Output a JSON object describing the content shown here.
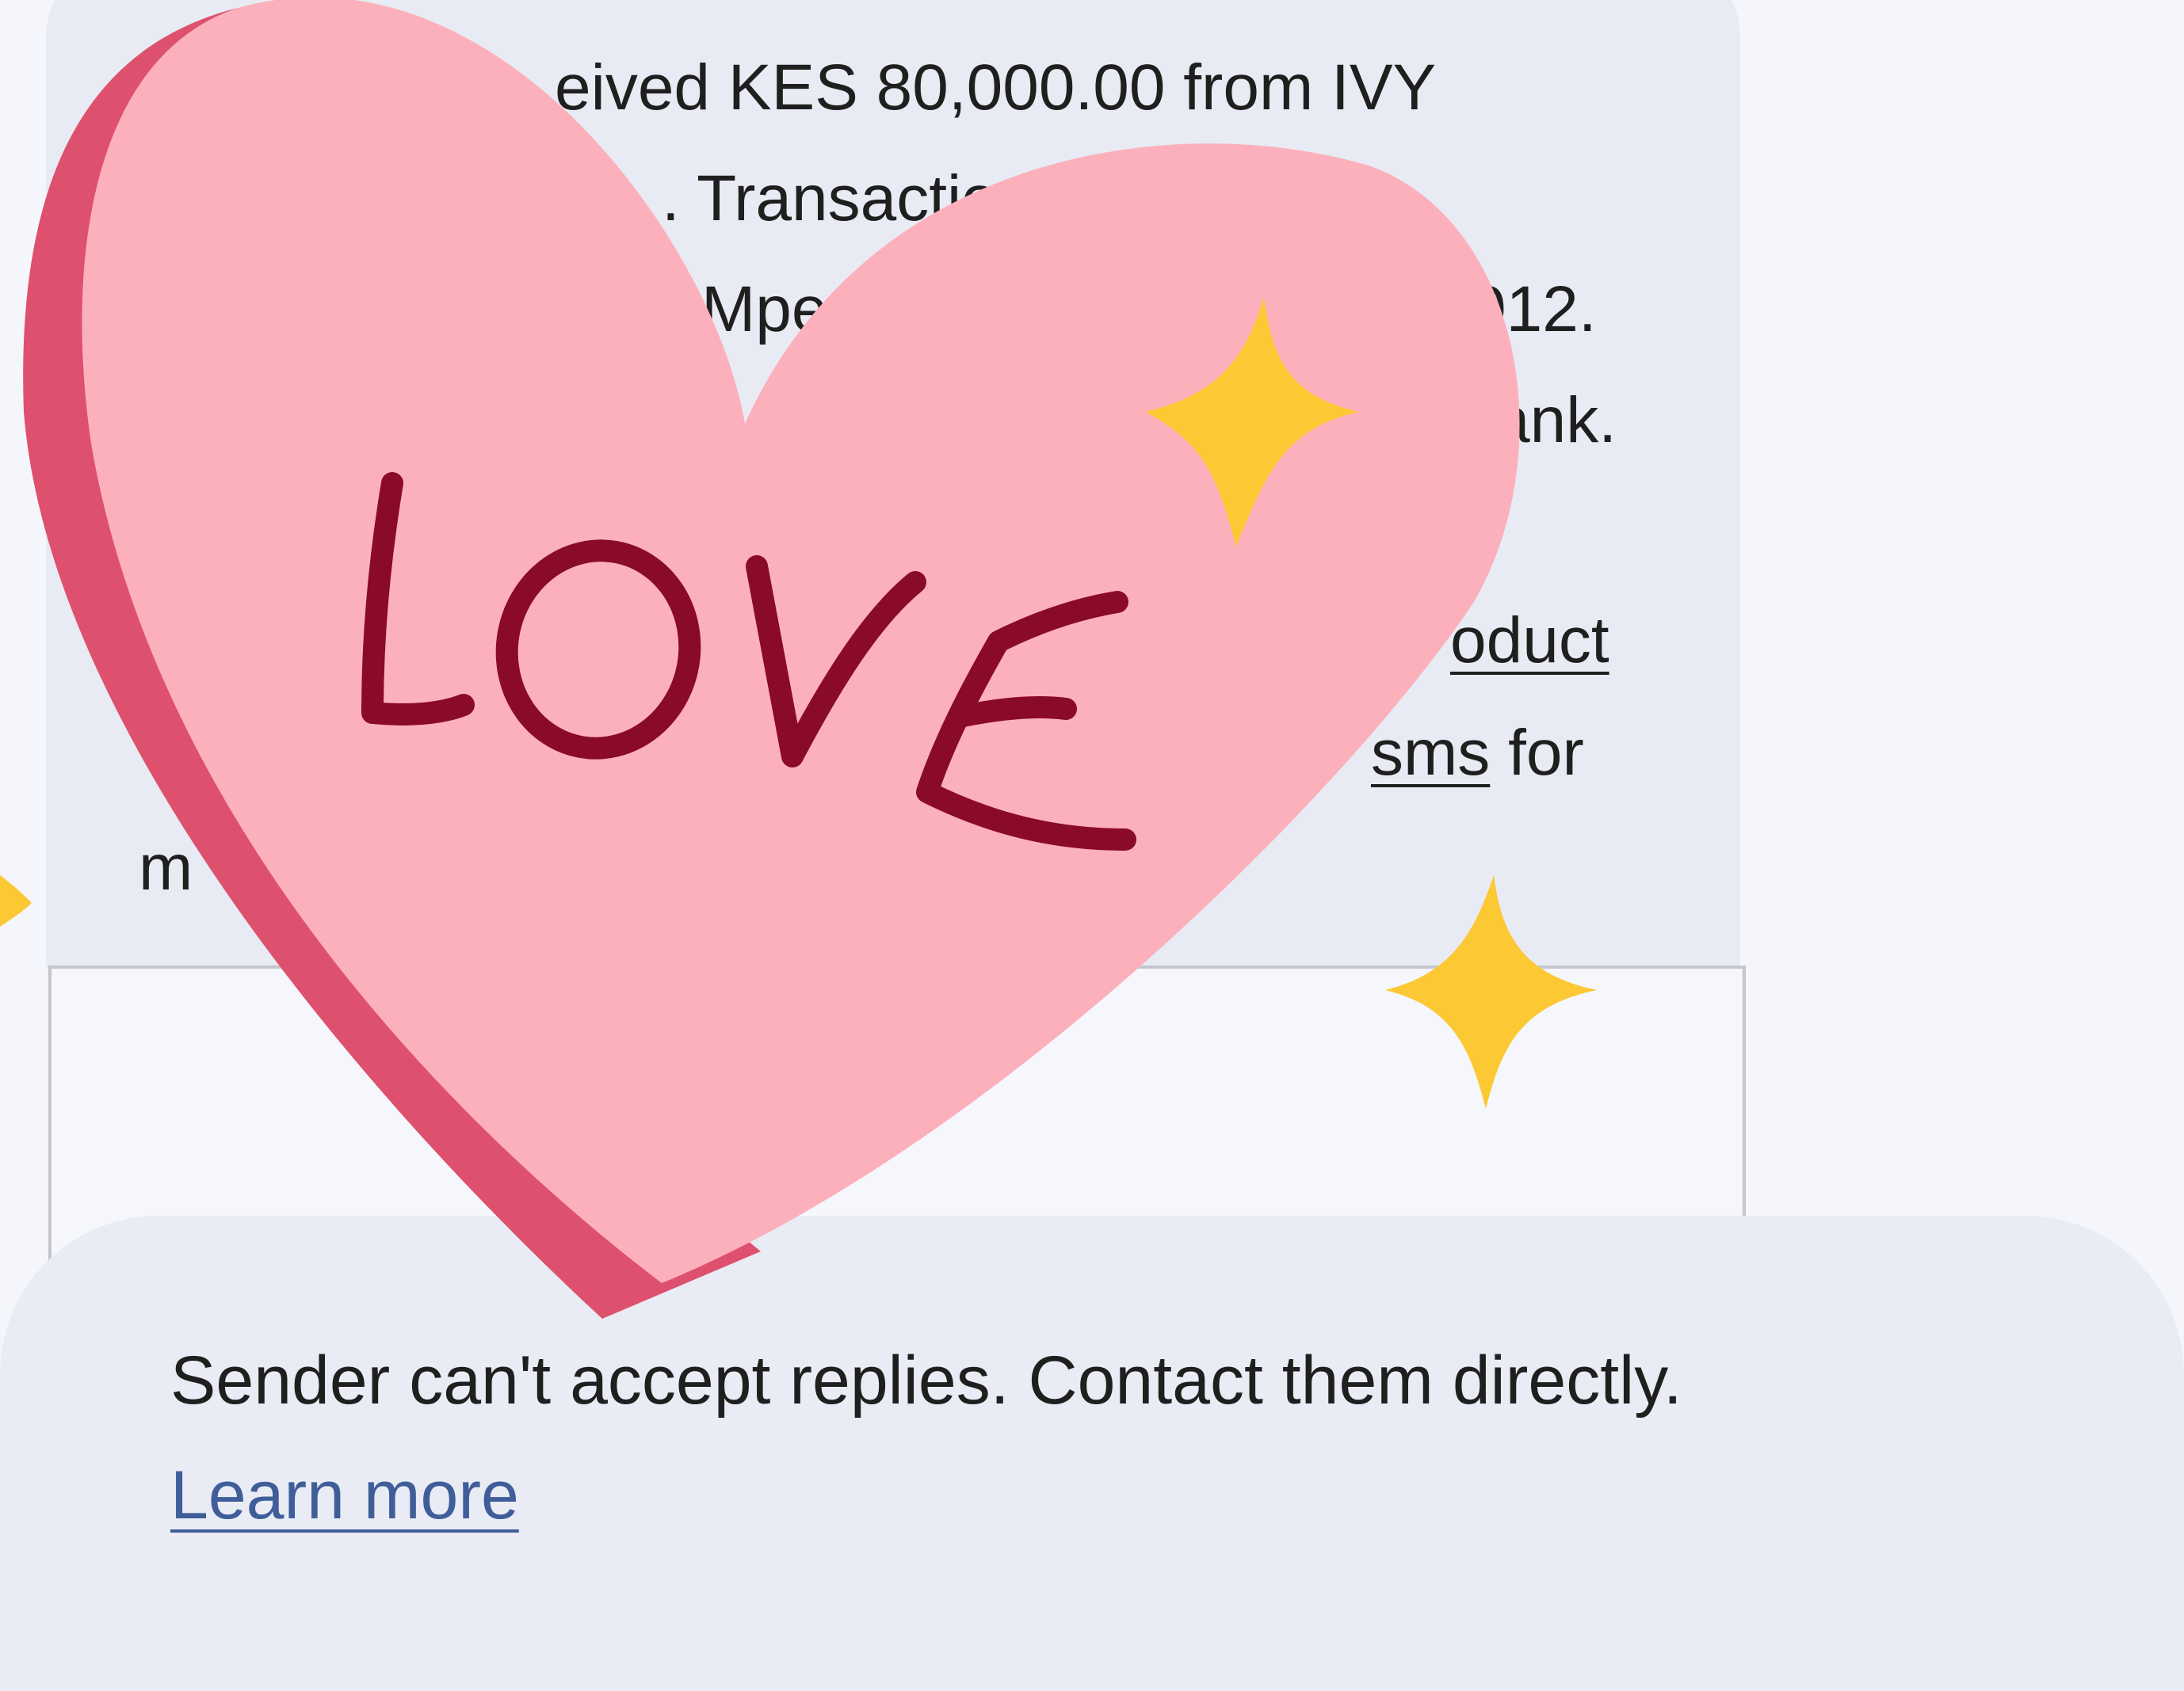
{
  "message": {
    "lines": [
      "eived KES 80,000.00 from IVY",
      ". Transactio",
      "Mpes",
      "012.",
      "ank.",
      "oduct",
      "sms",
      "for",
      "m"
    ]
  },
  "banner": {
    "text": "Sender can't accept replies. Contact them directly.",
    "link": "Learn more"
  },
  "sticker": {
    "label": "LOVE",
    "colors": {
      "heart": "#fcb0bb",
      "heart_edge": "#de516e",
      "text": "#8a0a2a",
      "sparkle": "#fcc834"
    }
  }
}
